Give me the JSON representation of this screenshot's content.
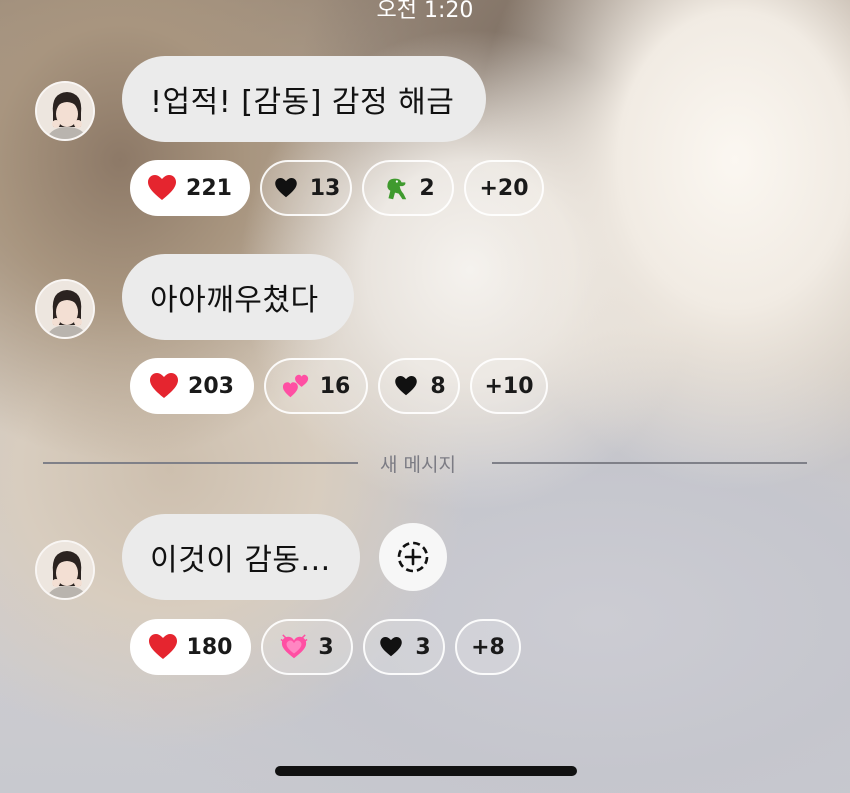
{
  "status_bar": {
    "time": "오전 1:20"
  },
  "messages": [
    {
      "text": "!업적! [감동] 감정 해금",
      "reactions": [
        {
          "icon": "red-heart-icon",
          "count": "221"
        },
        {
          "icon": "black-heart-icon",
          "count": "13"
        },
        {
          "icon": "t-rex-icon",
          "count": "2"
        },
        {
          "icon": "",
          "count": "+20"
        }
      ]
    },
    {
      "text": "아아깨우쳤다",
      "reactions": [
        {
          "icon": "red-heart-icon",
          "count": "203"
        },
        {
          "icon": "two-hearts-icon",
          "count": "16"
        },
        {
          "icon": "black-heart-icon",
          "count": "8"
        },
        {
          "icon": "",
          "count": "+10"
        }
      ]
    },
    {
      "text": "이것이 감동...",
      "reactions": [
        {
          "icon": "red-heart-icon",
          "count": "180"
        },
        {
          "icon": "growing-heart-icon",
          "count": "3"
        },
        {
          "icon": "black-heart-icon",
          "count": "3"
        },
        {
          "icon": "",
          "count": "+8"
        }
      ]
    }
  ],
  "divider": {
    "label": "새 메시지"
  },
  "colors": {
    "bubble": "#ebebeb",
    "heart_red": "#e5252f",
    "heart_pink": "#ff4fa3",
    "dino_green": "#3f9a2e"
  }
}
